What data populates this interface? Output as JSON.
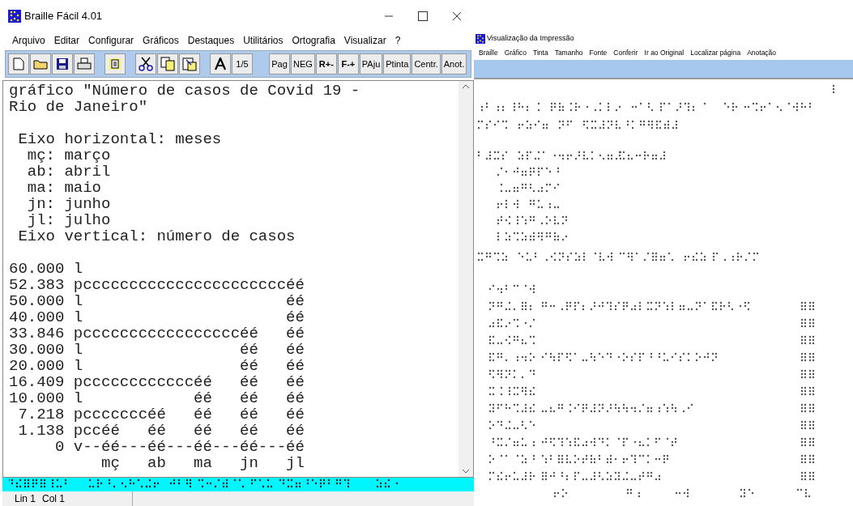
{
  "editor_window": {
    "title": "Braille Fácil 4.01",
    "menu": [
      "Arquivo",
      "Editar",
      "Configurar",
      "Gráficos",
      "Destaques",
      "Utilitários",
      "Ortografia",
      "Visualizar",
      "?"
    ],
    "toolbar_text_buttons": [
      {
        "label": "1/5",
        "bold": false
      },
      {
        "label": "Pag",
        "bold": false
      },
      {
        "label": "NEG",
        "bold": false
      },
      {
        "label": "R+-",
        "bold": true
      },
      {
        "label": "F-+",
        "bold": true
      },
      {
        "label": "PAju",
        "bold": false
      },
      {
        "label": "Ptinta",
        "bold": false
      },
      {
        "label": "Centr.",
        "bold": false
      },
      {
        "label": "Anot.",
        "bold": false
      }
    ],
    "text_blocks": [
      {
        "lines": [
          "gráfico \"Número de casos de Covid 19 -",
          "Rio de Janeiro\""
        ]
      },
      {
        "lines": [
          " Eixo horizontal: meses",
          "  mç: março",
          "  ab: abril",
          "  ma: maio",
          "  jn: junho",
          "  jl: julho",
          " Eixo vertical: número de casos"
        ]
      },
      {
        "lines": [
          "60.000 l",
          "52.383 pccccccccccccccccccccccéé",
          "50.000 l                      éé",
          "40.000 l                      éé",
          "33.846 pcccccccccccccccccéé   éé",
          "30.000 l                 éé   éé",
          "20.000 l                 éé   éé",
          "16.409 pccccccccccccéé   éé   éé",
          "10.000 l            éé   éé   éé",
          " 7.218 pcccccccéé   éé   éé   éé",
          " 1.138 pccéé   éé   éé   éé   éé",
          "     0 v--éé---éé---éé---éé---éé",
          "          mç   ab   ma   jn   jl"
        ]
      }
    ],
    "status_bar": {
      "line": "Lin 1",
      "column": "Col 1"
    }
  },
  "preview_window": {
    "title": "Visualização da Impressão",
    "menu": [
      "Braille",
      "Gráfico",
      "Tinta",
      "Tamanho",
      "Fonte",
      "Conferir",
      "Ir ao Original",
      "Localizar página",
      "Anotação"
    ]
  }
}
